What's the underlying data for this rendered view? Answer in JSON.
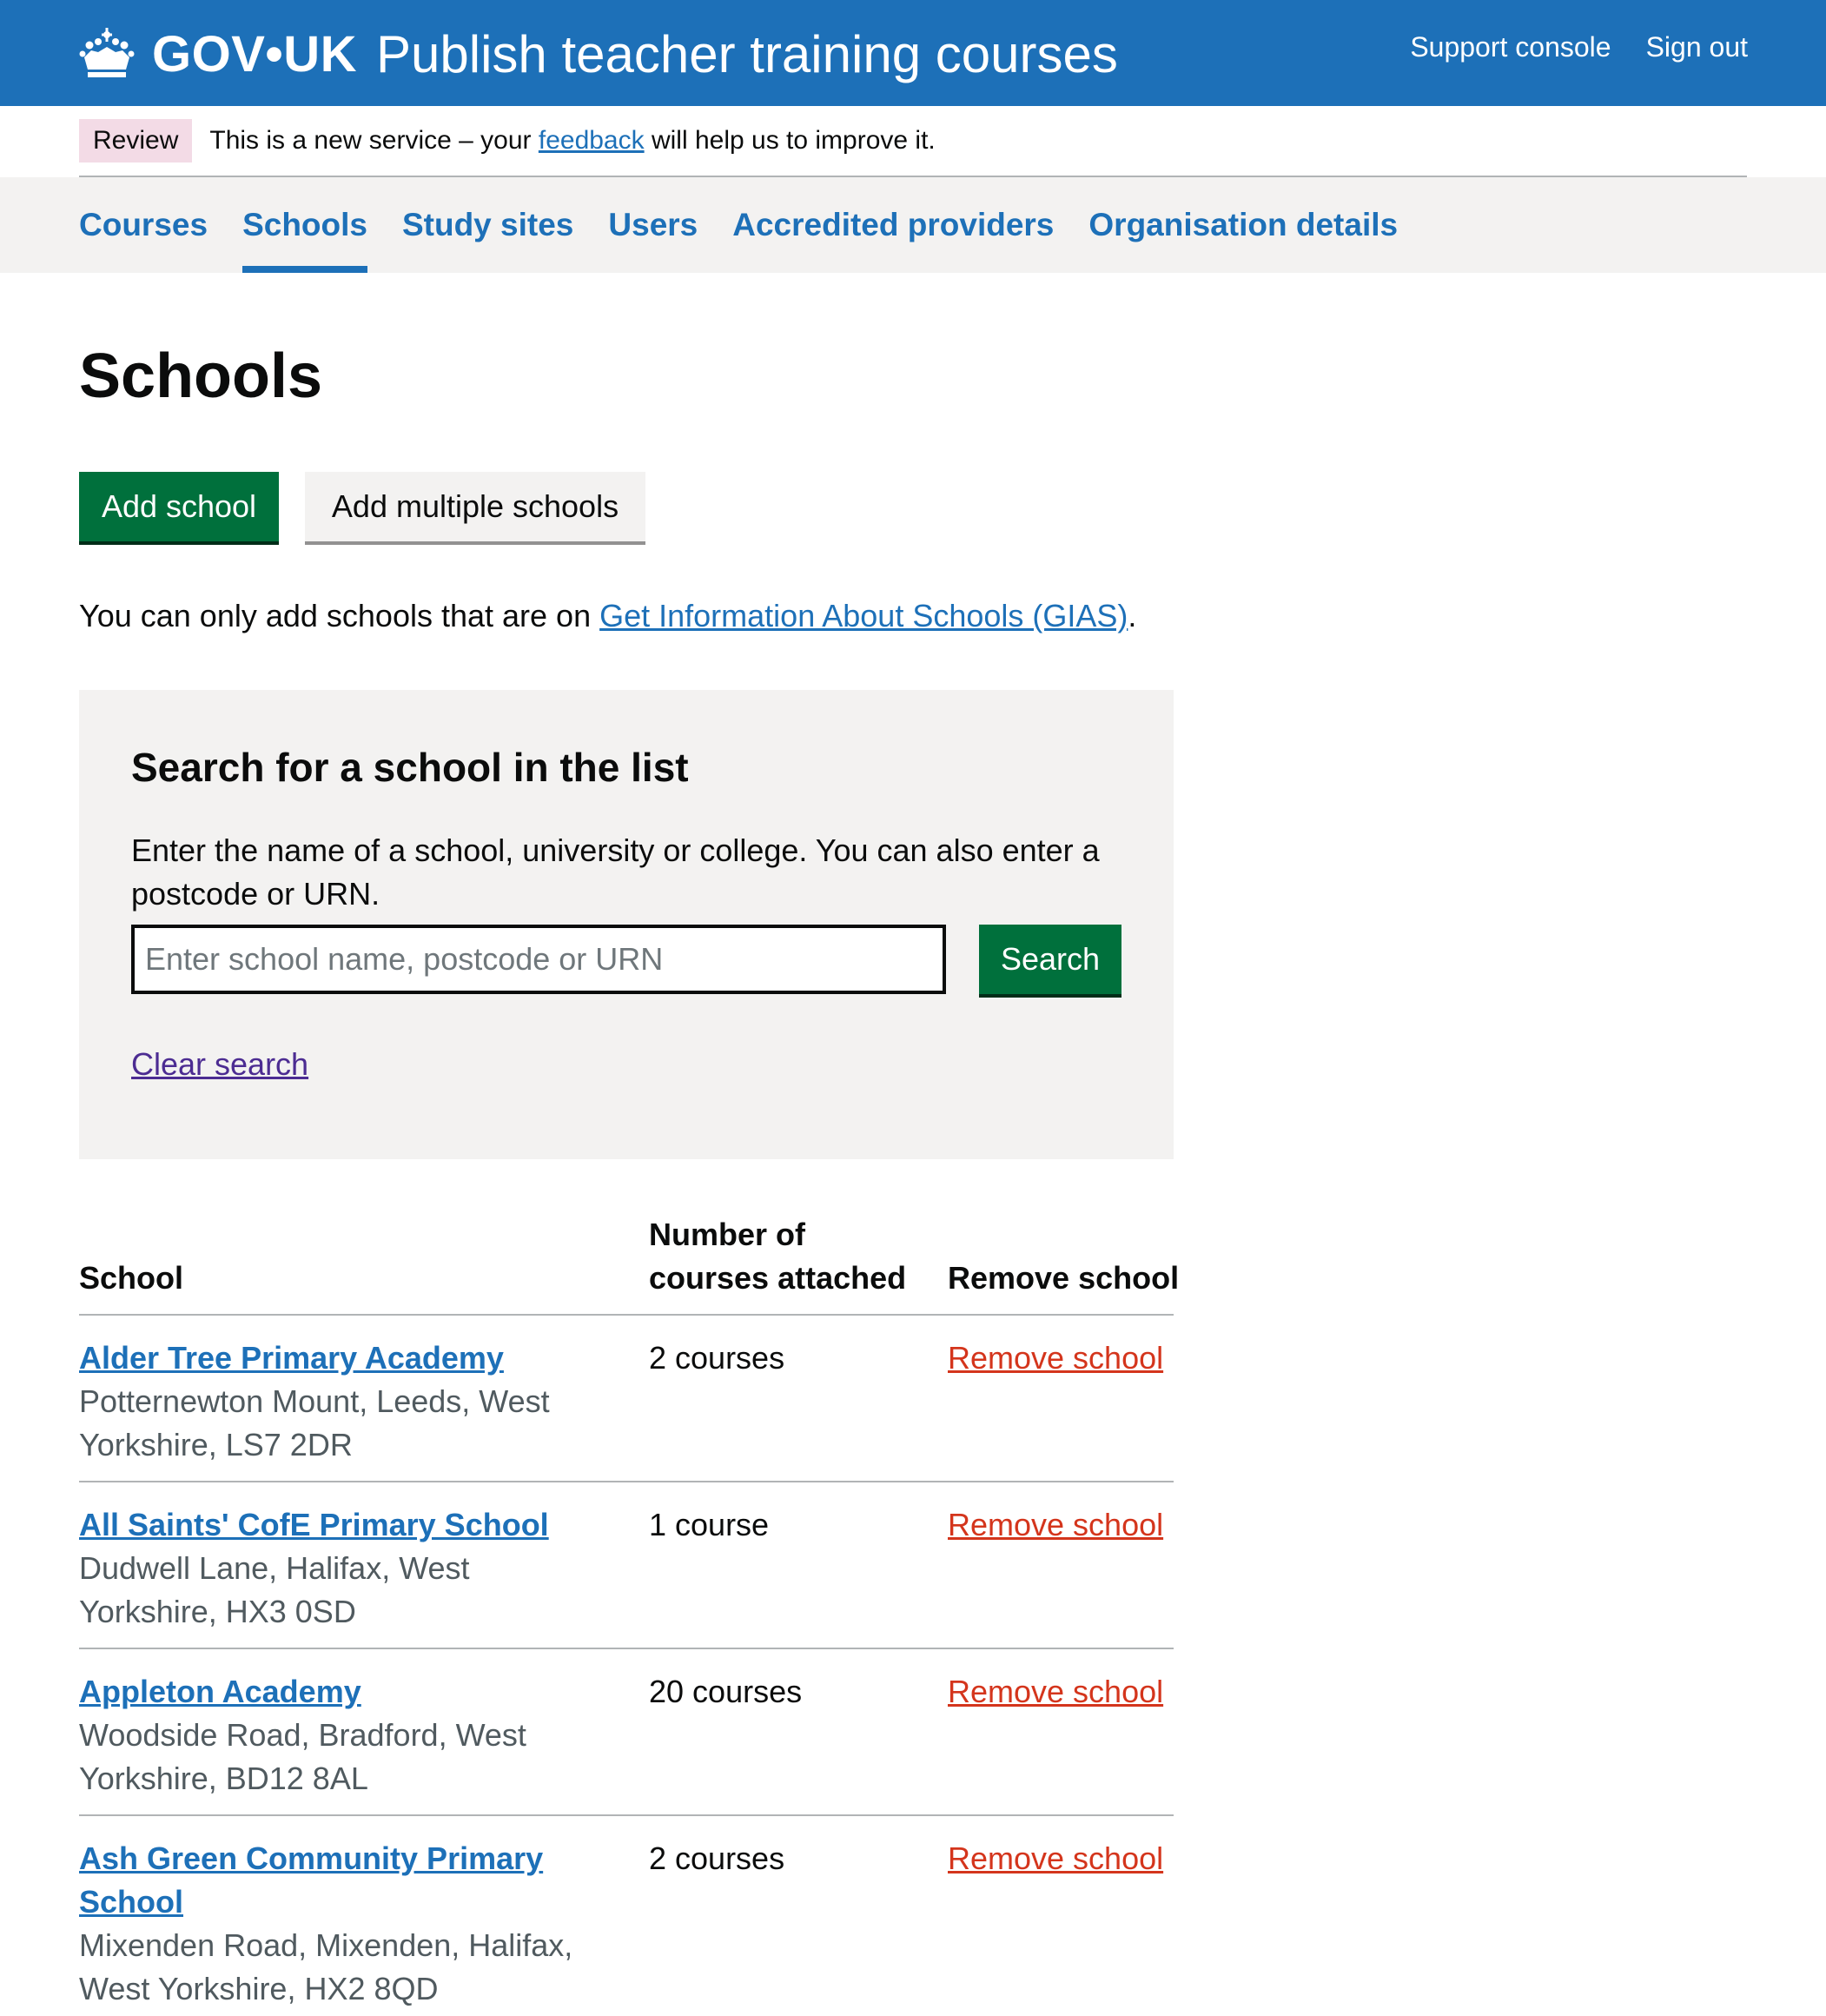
{
  "header": {
    "logo_text_left": "GOV",
    "logo_dot": "•",
    "logo_text_right": "UK",
    "service_name": "Publish teacher training courses",
    "nav": [
      "Support console",
      "Sign out"
    ]
  },
  "phase_banner": {
    "tag": "Review",
    "text_before": "This is a new service – your ",
    "link": "feedback",
    "text_after": " will help us to improve it."
  },
  "sub_nav": {
    "items": [
      "Courses",
      "Schools",
      "Study sites",
      "Users",
      "Accredited providers",
      "Organisation details"
    ],
    "active": "Schools"
  },
  "page_title": "Schools",
  "buttons": {
    "add_school": "Add school",
    "add_multiple": "Add multiple schools"
  },
  "gias": {
    "text_before": "You can only add schools that are on ",
    "link": "Get Information About Schools (GIAS)",
    "text_after": "."
  },
  "search": {
    "heading": "Search for a school in the list",
    "hint": "Enter the name of a school, university or college. You can also enter a postcode or URN.",
    "placeholder": "Enter school name, postcode or URN",
    "button": "Search",
    "clear": "Clear search"
  },
  "table": {
    "headers": {
      "school": "School",
      "count_line1": "Number of",
      "count_line2": "courses attached",
      "remove": "Remove school"
    },
    "rows": [
      {
        "name": "Alder Tree Primary Academy",
        "address": "Potternewton Mount, Leeds, West Yorkshire, LS7 2DR",
        "count": "2 courses",
        "action": "Remove school"
      },
      {
        "name": "All Saints' CofE Primary School",
        "address": "Dudwell Lane, Halifax, West Yorkshire, HX3 0SD",
        "count": "1 course",
        "action": "Remove school"
      },
      {
        "name": "Appleton Academy",
        "address": "Woodside Road, Bradford, West Yorkshire, BD12 8AL",
        "count": "20 courses",
        "action": "Remove school"
      },
      {
        "name": "Ash Green Community Primary School",
        "address": "Mixenden Road, Mixenden, Halifax, West Yorkshire, HX2 8QD",
        "count": "2 courses",
        "action": "Remove school"
      }
    ]
  },
  "colors": {
    "brand_blue": "#1d70b8",
    "button_green": "#00703c",
    "error_red": "#d4351c",
    "visited_purple": "#4c2c92",
    "phase_tag_bg": "#f3dbe6"
  }
}
